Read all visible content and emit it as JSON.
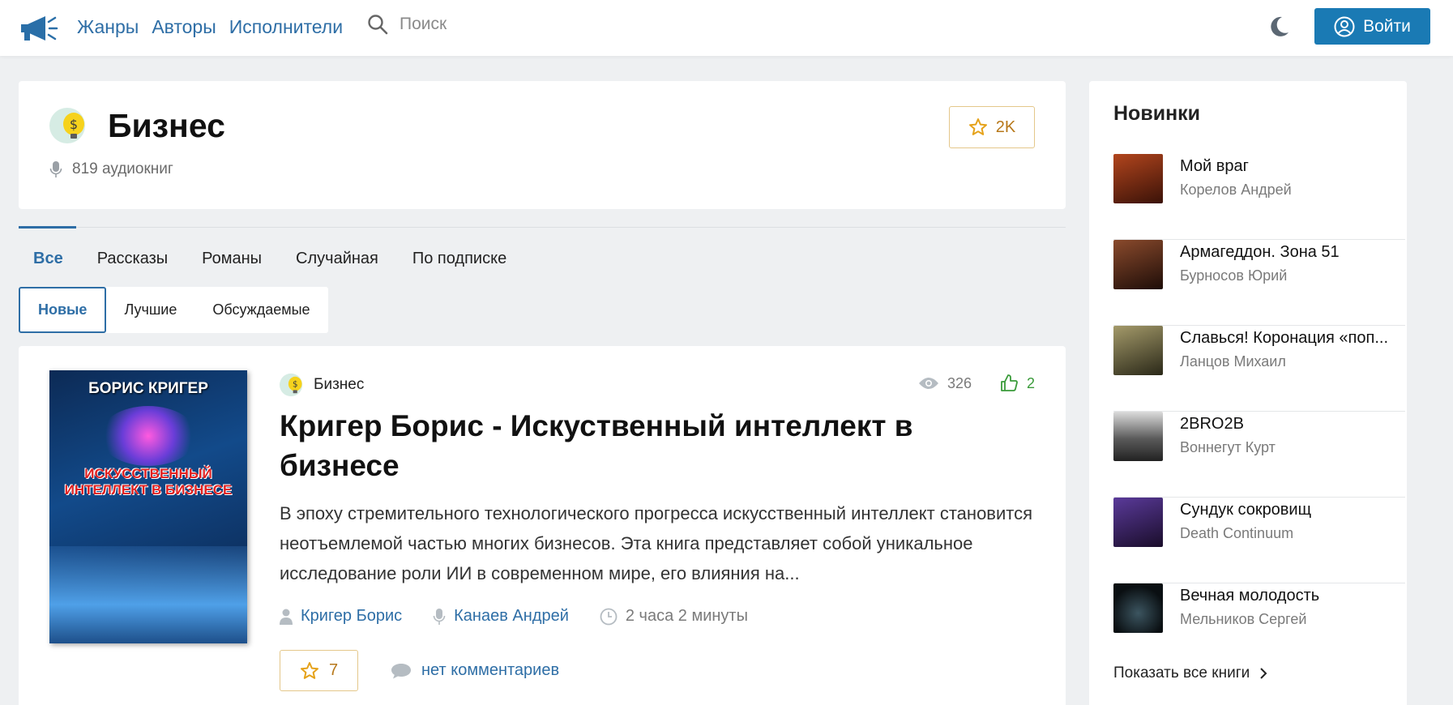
{
  "header": {
    "nav": [
      "Жанры",
      "Авторы",
      "Исполнители"
    ],
    "search_placeholder": "Поиск",
    "login_label": "Войти"
  },
  "genre": {
    "title": "Бизнес",
    "count": "819 аудиокниг",
    "favorites": "2K"
  },
  "tabs": [
    "Все",
    "Рассказы",
    "Романы",
    "Случайная",
    "По подписке"
  ],
  "sort": [
    "Новые",
    "Лучшие",
    "Обсуждаемые"
  ],
  "book": {
    "genre": "Бизнес",
    "views": "326",
    "likes": "2",
    "title": "Кригер Борис - Искуственный интеллект в бизнесе",
    "description": "В эпоху стремительного технологического прогресса искусственный интеллект становится неотъемлемой частью многих бизнесов. Эта книга представляет собой уникальное исследование роли ИИ в современном мире, его влияния на...",
    "author": "Кригер Борис",
    "reader": "Канаев Андрей",
    "duration": "2 часа 2 минуты",
    "favorites": "7",
    "comments": "нет комментариев",
    "cover_author": "БОРИС КРИГЕР",
    "cover_title": "ИСКУССТВЕННЫЙ ИНТЕЛЛЕКТ В БИЗНЕСЕ"
  },
  "sidebar": {
    "title": "Новинки",
    "items": [
      {
        "title": "Мой враг",
        "author": "Корелов Андрей",
        "color": "#7a2c12"
      },
      {
        "title": "Армагеддон. Зона 51",
        "author": "Бурносов Юрий",
        "color": "#4a2a1e"
      },
      {
        "title": "Славься! Коронация «поп...",
        "author": "Ланцов Михаил",
        "color": "#4b4a36"
      },
      {
        "title": "2BRO2B",
        "author": "Воннегут Курт",
        "color": "#3a3a3a"
      },
      {
        "title": "Сундук сокровищ",
        "author": "Death Continuum",
        "color": "#2a1a4a"
      },
      {
        "title": "Вечная молодость",
        "author": "Мельников Сергей",
        "color": "#0e1418"
      }
    ],
    "show_all": "Показать все книги"
  }
}
